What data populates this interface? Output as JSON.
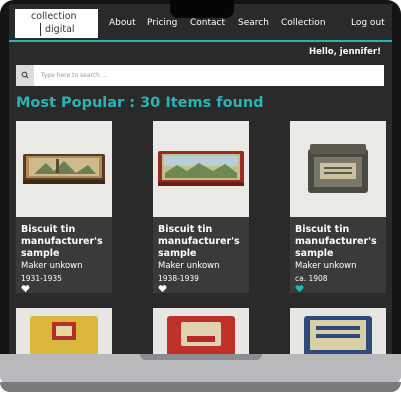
{
  "logo": {
    "line1": "collection",
    "line2": "digital"
  },
  "nav": {
    "about": "About",
    "pricing": "Pricing",
    "contact": "Contact",
    "search": "Search",
    "collection": "Collection",
    "logout": "Log out"
  },
  "greeting": "Hello, jennifer!",
  "search": {
    "placeholder": "Type here to search ..."
  },
  "results_title": "Most Popular : 30 Items found",
  "items": [
    {
      "title": "Biscuit tin manufacturer's sample",
      "maker": "Maker unkown",
      "date": "1931-1935",
      "favorited": false
    },
    {
      "title": "Biscuit tin manufacturer's sample",
      "maker": "Maker unkown",
      "date": "1938-1939",
      "favorited": false
    },
    {
      "title": "Biscuit tin manufacturer's sample",
      "maker": "Maker unkown",
      "date": "ca. 1908",
      "favorited": true
    }
  ],
  "icons": {
    "search": "search-icon",
    "heart": "heart-icon"
  },
  "colors": {
    "accent": "#2ab3b7",
    "background": "#2a2a2a",
    "card": "#3a3a3a"
  }
}
